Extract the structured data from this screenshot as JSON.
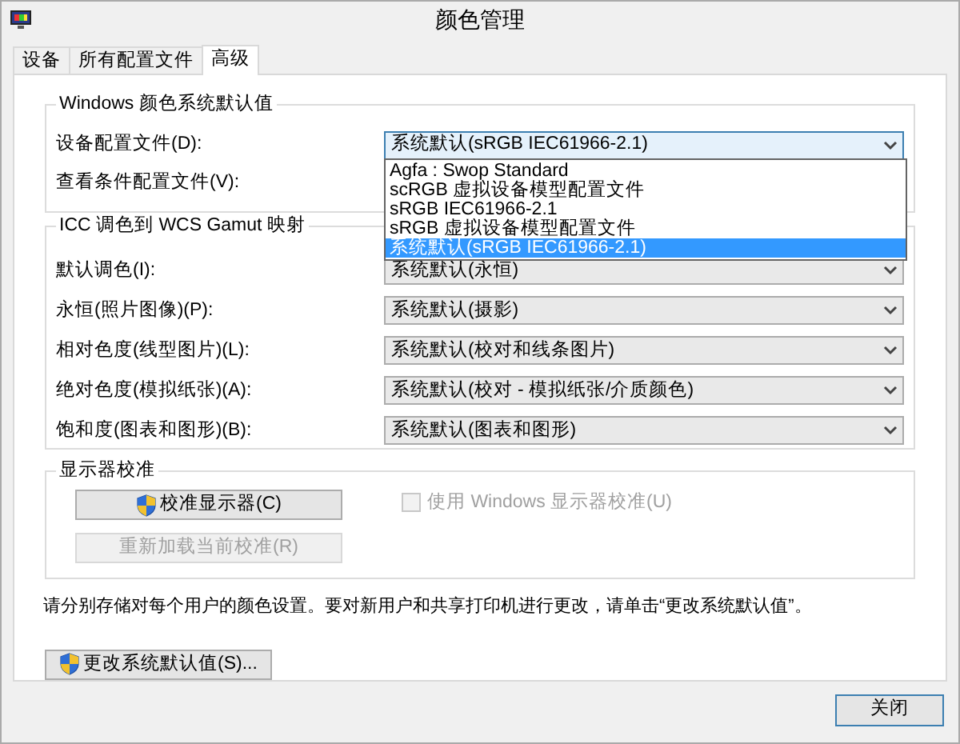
{
  "window": {
    "title": "颜色管理"
  },
  "tabs": [
    {
      "label": "设备",
      "selected": false
    },
    {
      "label": "所有配置文件",
      "selected": false
    },
    {
      "label": "高级",
      "selected": true
    }
  ],
  "windows_defaults": {
    "title": "Windows 颜色系统默认值",
    "rows": [
      {
        "label": "设备配置文件(D):",
        "value": "系统默认(sRGB IEC61966-2.1)",
        "expanded": true,
        "options": [
          {
            "label": "Agfa : Swop Standard",
            "selected": false
          },
          {
            "label": "scRGB 虚拟设备模型配置文件",
            "selected": false
          },
          {
            "label": "sRGB IEC61966-2.1",
            "selected": false
          },
          {
            "label": "sRGB 虚拟设备模型配置文件",
            "selected": false
          },
          {
            "label": "系统默认(sRGB IEC61966-2.1)",
            "selected": true
          }
        ]
      },
      {
        "label": "查看条件配置文件(V):"
      }
    ]
  },
  "gamut_mapping": {
    "title": "ICC 调色到 WCS Gamut 映射",
    "rows": [
      {
        "label": "默认调色(I):",
        "value": "系统默认(永恒)"
      },
      {
        "label": "永恒(照片图像)(P):",
        "value": "系统默认(摄影)"
      },
      {
        "label": "相对色度(线型图片)(L):",
        "value": "系统默认(校对和线条图片)"
      },
      {
        "label": "绝对色度(模拟纸张)(A):",
        "value": "系统默认(校对 - 模拟纸张/介质颜色)"
      },
      {
        "label": "饱和度(图表和图形)(B):",
        "value": "系统默认(图表和图形)"
      }
    ]
  },
  "calibration": {
    "title": "显示器校准",
    "calibrate_button": {
      "label": "校准显示器(C)",
      "disabled": false
    },
    "reload_button": {
      "label": "重新加载当前校准(R)",
      "disabled": true
    },
    "checkbox": {
      "label": "使用 Windows 显示器校准(U)",
      "checked": false,
      "disabled": true
    }
  },
  "note": "请分别存储对每个用户的颜色设置。要对新用户和共享打印机进行更改，请单击“更改系统默认值”。",
  "change_defaults_button": {
    "label": "更改系统默认值(S)..."
  },
  "close_button": {
    "label": "关闭"
  }
}
